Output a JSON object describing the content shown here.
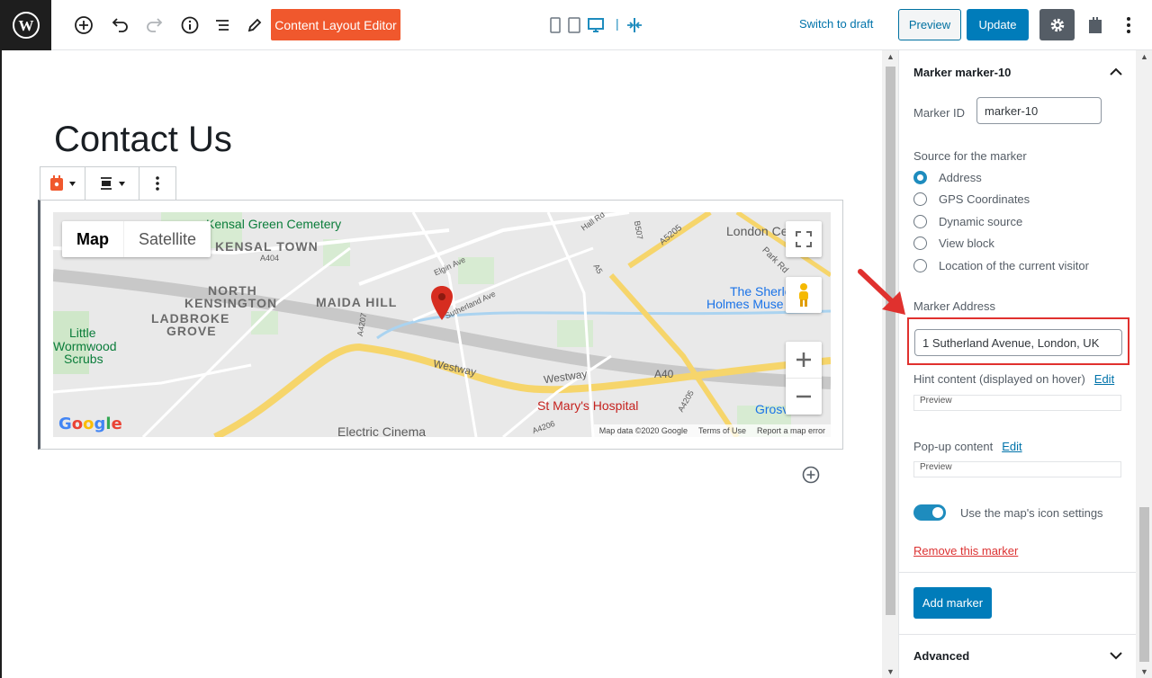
{
  "toolbar": {
    "content_layout_editor": "Content Layout Editor",
    "switch_to_draft": "Switch to draft",
    "preview": "Preview",
    "update": "Update"
  },
  "editor": {
    "title": "Contact Us"
  },
  "map": {
    "type_map": "Map",
    "type_satellite": "Satellite",
    "labels": {
      "kensal_green": "Kensal Green Cemetery",
      "kensal_town": "KENSAL TOWN",
      "north_kensington": "NORTH",
      "north_kensington2": "KENSINGTON",
      "ladbroke_grove": "LADBROKE",
      "ladbroke_grove2": "GROVE",
      "maida_hill": "MAIDA HILL",
      "little_wormwood": "Little",
      "little_wormwood2": "Wormwood",
      "little_wormwood3": "Scrubs",
      "london_centre": "London Ce",
      "the_sherlock": "The Sherlo",
      "holmes_museum": "Holmes Muse",
      "westway1": "Westway",
      "westway2": "Westway",
      "a40": "A40",
      "st_marys": "St Mary's Hospital",
      "grosv": "Grosv",
      "electric_cinema": "Electric Cinema",
      "a404": "A404",
      "a5205": "A5205",
      "elgin_ave": "Elgin Ave",
      "sutherland_ave": "Sutherland Ave",
      "hall_rd": "Hall Rd",
      "park_rd": "Park Rd",
      "a5": "A5",
      "a4207": "A4207",
      "a4205": "A4205",
      "a4206": "A4206",
      "b507": "B507"
    },
    "footer": {
      "map_data": "Map data ©2020 Google",
      "terms": "Terms of Use",
      "report": "Report a map error"
    },
    "google": "Google"
  },
  "sidebar": {
    "panel_title": "Marker marker-10",
    "marker_id_label": "Marker ID",
    "marker_id_value": "marker-10",
    "source_label": "Source for the marker",
    "sources": [
      {
        "label": "Address",
        "selected": true
      },
      {
        "label": "GPS Coordinates",
        "selected": false
      },
      {
        "label": "Dynamic source",
        "selected": false
      },
      {
        "label": "View block",
        "selected": false
      },
      {
        "label": "Location of the current visitor",
        "selected": false
      }
    ],
    "marker_address_label": "Marker Address",
    "marker_address_value": "1 Sutherland Avenue, London, UK",
    "hint_label": "Hint content (displayed on hover)",
    "edit": "Edit",
    "preview": "Preview",
    "popup_label": "Pop-up content",
    "use_icon_settings": "Use the map's icon settings",
    "remove_marker": "Remove this marker",
    "add_marker": "Add marker",
    "advanced": "Advanced"
  },
  "colors": {
    "accent": "#007cba",
    "cle_button": "#f0582d",
    "highlight": "#e0312e"
  }
}
